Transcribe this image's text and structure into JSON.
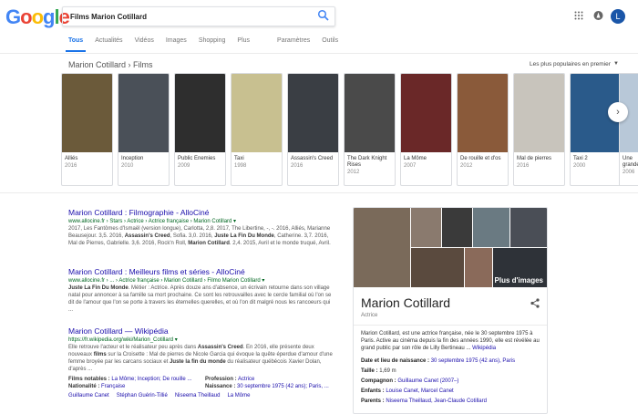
{
  "logo": {
    "letters": [
      "G",
      "o",
      "o",
      "g",
      "l",
      "e"
    ]
  },
  "search": {
    "query": "Films Marion Cotillard"
  },
  "user": {
    "initial": "L"
  },
  "tabs": [
    "Tous",
    "Actualités",
    "Vidéos",
    "Images",
    "Shopping",
    "Plus",
    "Paramètres",
    "Outils"
  ],
  "carousel": {
    "title": "Marion Cotillard › Films",
    "sort": "Les plus populaires en premier",
    "films": [
      {
        "title": "Alliés",
        "year": "2016",
        "color": "#6b5a3a"
      },
      {
        "title": "Inception",
        "year": "2010",
        "color": "#4a5058"
      },
      {
        "title": "Public Enemies",
        "year": "2009",
        "color": "#2e2e2e"
      },
      {
        "title": "Taxi",
        "year": "1998",
        "color": "#c8c090"
      },
      {
        "title": "Assassin's Creed",
        "year": "2016",
        "color": "#3a3e44"
      },
      {
        "title": "The Dark Knight Rises",
        "year": "2012",
        "color": "#4a4a4a"
      },
      {
        "title": "La Môme",
        "year": "2007",
        "color": "#6a2828"
      },
      {
        "title": "De rouille et d'os",
        "year": "2012",
        "color": "#8a5a3a"
      },
      {
        "title": "Mal de pierres",
        "year": "2016",
        "color": "#c8c4bc"
      },
      {
        "title": "Taxi 2",
        "year": "2000",
        "color": "#2a5a8a"
      }
    ],
    "partial_card": {
      "title": "Une",
      "title2": "grande",
      "year": "2006"
    }
  },
  "results": [
    {
      "title": "Marion Cotillard : Filmographie - AlloCiné",
      "url": "www.allocine.fr › Stars › Actrice › Actrice française › Marion Cotillard ▾",
      "snippet": "2017, Les Fantômes d'Ismaël (version longue), Carlotta, 2,8. 2017, The Libertine, -, -. 2016, Alliés, Marianne Beausejour. 3,5. 2016, Assassin's Creed, Sofia. 3,0. 2016, Juste La Fin Du Monde, Catherine. 3,7. 2016, Mal de Pierres, Gabrielle. 3,6. 2016, Rock'n Roll, Marion Cotillard. 2,4. 2015, Avril et le monde truqué, Avril."
    },
    {
      "title": "Marion Cotillard : Meilleurs films et séries - AlloCiné",
      "url": "www.allocine.fr › ... › Actrice française › Marion Cotillard › Filmo Marion Cotillard ▾",
      "snippet": "Juste La Fin Du Monde. Métier : Actrice. Après douze ans d'absence, un écrivain retourne dans son village natal pour annoncer à sa famille sa mort prochaine. Ce sont les retrouvailles avec le cercle familial où l'on se dit de l'amour que l'on se porte à travers les éternelles querelles, et où l'on dit malgré nous les rancoeurs qui ..."
    },
    {
      "title": "Marion Cotillard — Wikipédia",
      "url": "https://fr.wikipedia.org/wiki/Marion_Cotillard ▾",
      "snippet": "Elle retrouve l'acteur et le réalisateur peu après dans Assassin's Creed. En 2016, elle présente deux nouveaux films sur la Croisette : Mal de pierres de Nicole Garcia qui évoque la quête éperdue d'amour d'une femme broyée par les carcans sociaux et Juste la fin du monde du réalisateur québécois Xavier Dolan, d'après ...",
      "facts": [
        {
          "k": "Films notables :",
          "v": "La Môme; Inception; De rouille ..."
        },
        {
          "k": "Profession :",
          "v": "Actrice"
        },
        {
          "k": "Nationalité :",
          "v": "Française"
        },
        {
          "k": "Naissance :",
          "v": "30 septembre 1975 (42 ans); Paris, ..."
        }
      ],
      "links": [
        "Guillaume Canet",
        "Stéphan Guérin-Tillié",
        "Niseema Theillaud",
        "La Môme"
      ]
    }
  ],
  "knowledge_panel": {
    "more_images": "Plus d'images",
    "name": "Marion Cotillard",
    "subtitle": "Actrice",
    "description": "Marion Cotillard, est une actrice française, née le 30 septembre 1975 à Paris. Active au cinéma depuis la fin des années 1990, elle est révélée au grand public par son rôle de Lilly Bertineau ...",
    "source": "Wikipédia",
    "facts": [
      {
        "k": "Date et lieu de naissance :",
        "v": "30 septembre 1975 (42 ans), Paris"
      },
      {
        "k": "Taille :",
        "v": "1,69 m"
      },
      {
        "k": "Compagnon :",
        "v": "Guillaume Canet (2007–)"
      },
      {
        "k": "Enfants :",
        "v": "Louise Canet, Marcel Canet"
      },
      {
        "k": "Parents :",
        "v": "Niseema Theillaud, Jean-Claude Cotillard"
      }
    ]
  }
}
